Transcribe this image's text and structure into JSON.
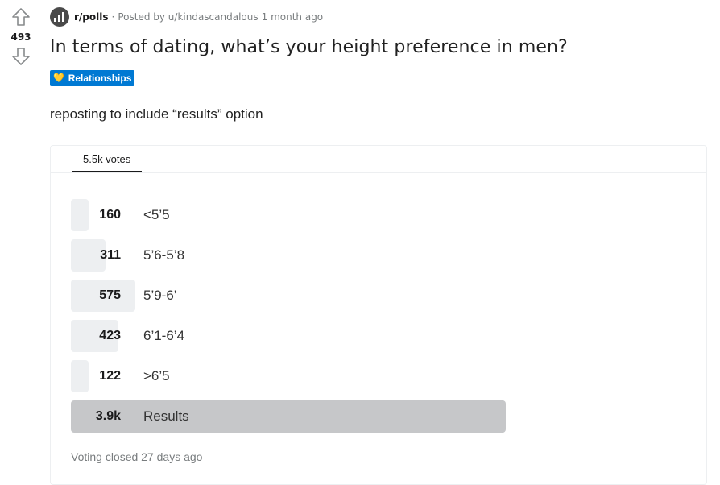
{
  "vote": {
    "score": "493"
  },
  "post": {
    "subreddit": "r/polls",
    "separator": "·",
    "posted_by": "Posted by u/kindascandalous",
    "time": "1 month ago",
    "title": "In terms of dating, what’s your height preference in men?",
    "flair": "Relationships",
    "body": "reposting to include “results” option"
  },
  "poll": {
    "tab_label": "5.5k votes",
    "options": [
      {
        "count": "160",
        "label": "<5’5",
        "votes": 160
      },
      {
        "count": "311",
        "label": "5’6-5’8",
        "votes": 311
      },
      {
        "count": "575",
        "label": "5’9-6’",
        "votes": 575
      },
      {
        "count": "423",
        "label": "6’1-6’4",
        "votes": 423
      },
      {
        "count": "122",
        "label": ">6’5",
        "votes": 122
      },
      {
        "count": "3.9k",
        "label": "Results",
        "votes": 3900,
        "selected": true
      }
    ],
    "status": "Voting closed 27 days ago"
  },
  "colors": {
    "flair_bg": "#0079d3",
    "bar": "#edeff1",
    "bar_selected": "#c6c7c9"
  },
  "icons": {
    "upvote": "upvote-arrow-icon",
    "downvote": "downvote-arrow-icon",
    "subreddit": "subreddit-avatar-icon",
    "flair": "heart-icon"
  }
}
